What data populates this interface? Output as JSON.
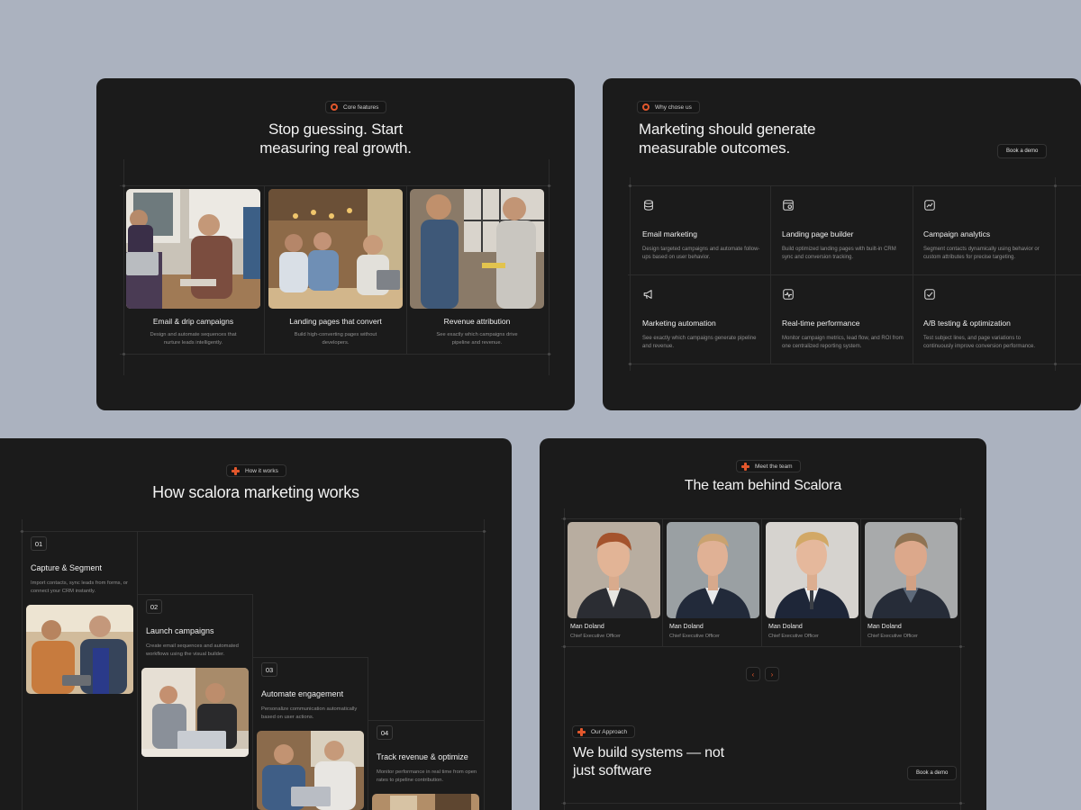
{
  "panel1": {
    "pill": "Core features",
    "heading_line1": "Stop guessing. Start",
    "heading_line2": "measuring real growth.",
    "cards": [
      {
        "title": "Email & drip campaigns",
        "desc": "Design and automate sequences that nurture leads intelligently."
      },
      {
        "title": "Landing pages that convert",
        "desc": "Build high-converting pages without developers."
      },
      {
        "title": "Revenue attribution",
        "desc": "See exactly which campaigns drive pipeline and revenue."
      }
    ]
  },
  "panel2": {
    "pill": "Why chose us",
    "heading_line1": "Marketing should generate",
    "heading_line2": "measurable outcomes.",
    "button": "Book a demo",
    "features": [
      {
        "icon": "database-icon",
        "title": "Email marketing",
        "desc": "Design targeted campaigns and automate follow-ups based on user behavior."
      },
      {
        "icon": "browser-settings-icon",
        "title": "Landing page builder",
        "desc": "Build optimized landing pages with built-in CRM sync and conversion tracking."
      },
      {
        "icon": "chart-line-icon",
        "title": "Campaign analytics",
        "desc": "Segment contacts dynamically using behavior or custom attributes for precise targeting."
      },
      {
        "icon": "megaphone-icon",
        "title": "Marketing automation",
        "desc": "See exactly which campaigns generate pipeline and revenue."
      },
      {
        "icon": "pulse-icon",
        "title": "Real-time performance",
        "desc": "Monitor campaign metrics, lead flow, and ROI from one centralized reporting system."
      },
      {
        "icon": "checkbox-icon",
        "title": "A/B testing & optimization",
        "desc": "Test subject lines, and page variations to continuously improve conversion performance."
      }
    ]
  },
  "panel3": {
    "pill": "How it works",
    "heading": "How scalora marketing works",
    "steps": [
      {
        "num": "01",
        "title": "Capture & Segment",
        "desc": "Import contacts, sync leads from forms, or connect your CRM instantly."
      },
      {
        "num": "02",
        "title": "Launch campaigns",
        "desc": "Create email sequences and automated workflows using the visual builder."
      },
      {
        "num": "03",
        "title": "Automate engagement",
        "desc": "Personalize communication automatically based on user actions."
      },
      {
        "num": "04",
        "title": "Track revenue & optimize",
        "desc": "Monitor performance in real time from open rates to pipeline contribution."
      }
    ]
  },
  "panel4": {
    "pill": "Meet the team",
    "heading": "The team behind Scalora",
    "members": [
      {
        "name": "Man Doland",
        "role": "Chief Executive Officer"
      },
      {
        "name": "Man Doland",
        "role": "Chief Executive Officer"
      },
      {
        "name": "Man Doland",
        "role": "Chief Executive Officer"
      },
      {
        "name": "Man Doland",
        "role": "Chief Executive Officer"
      }
    ],
    "prev": "‹",
    "next": "›",
    "approach_pill": "Our Approach",
    "approach_line1": "We build systems — not",
    "approach_line2": "just software",
    "button": "Book a demo"
  }
}
